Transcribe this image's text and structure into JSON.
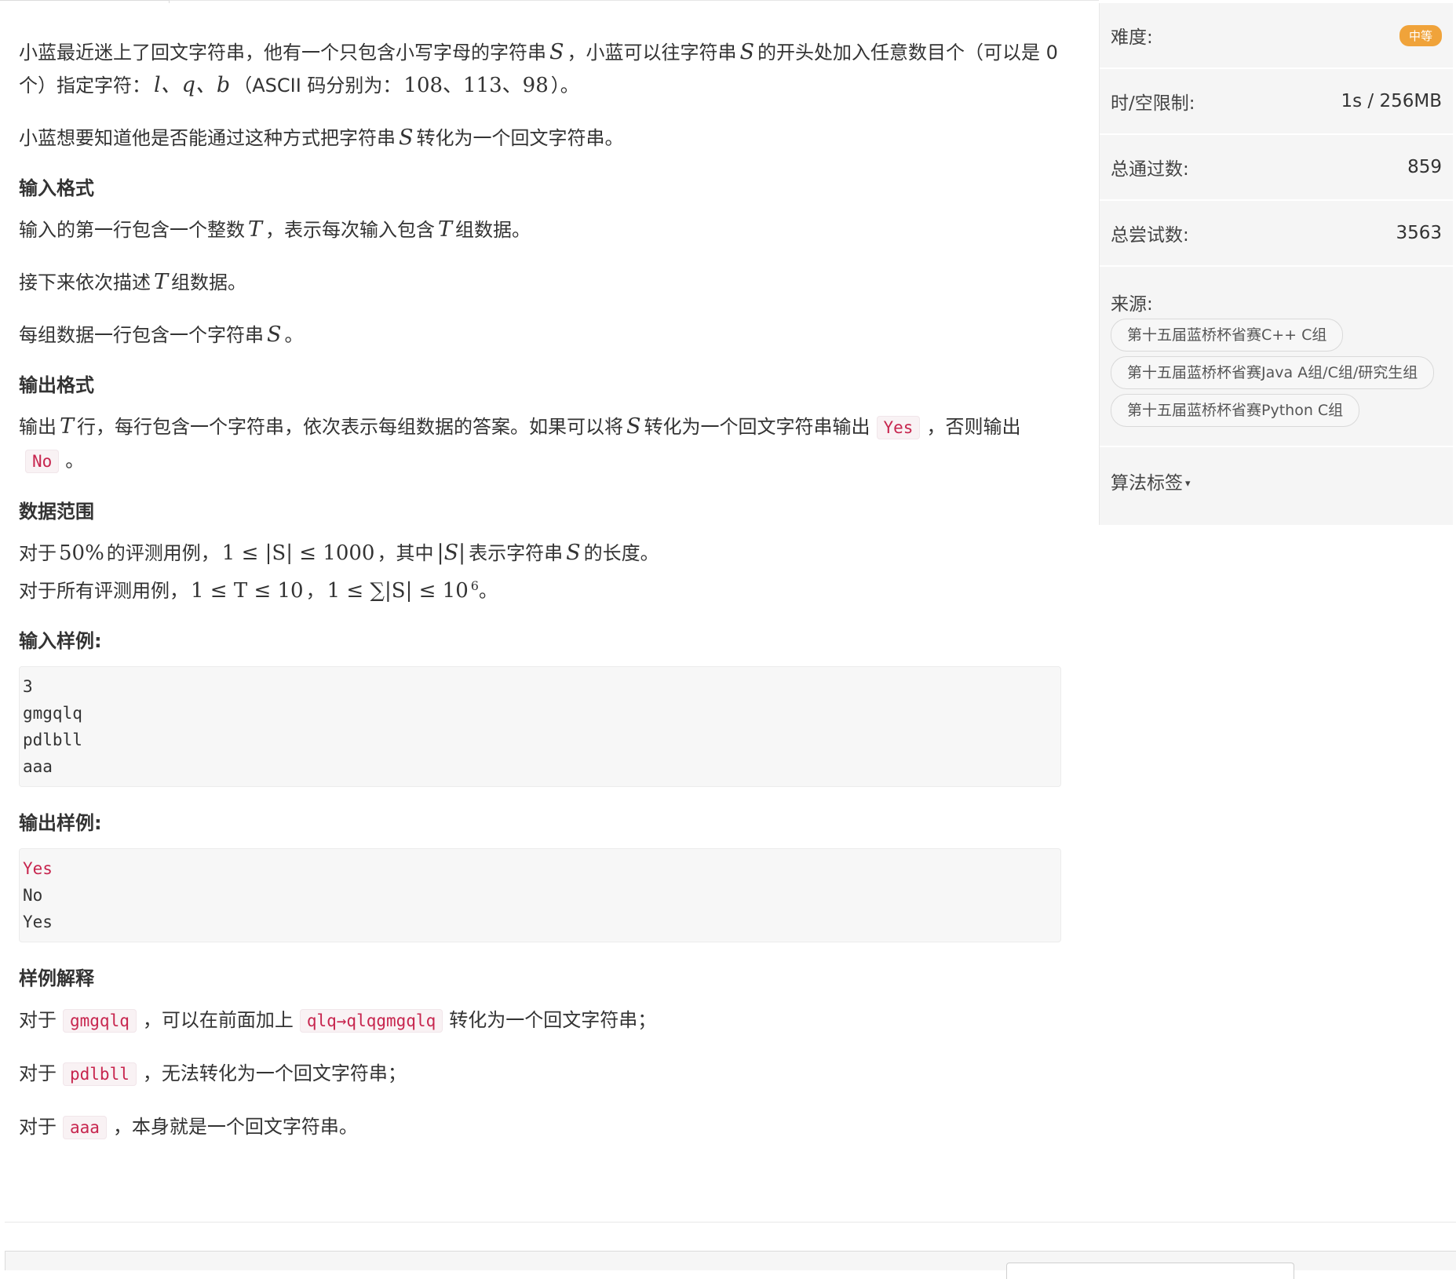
{
  "problem": {
    "p1a": "小蓝最近迷上了回文字符串，他有一个只包含小写字母的字符串",
    "p1b": "，小蓝可以往字符串",
    "p1c": "的开头处加入任意数目个（可以是 0 个）指定字符：",
    "p1d": "（ASCII 码分别为：",
    "p1e": "）。",
    "var_S": "S",
    "var_T": "T",
    "chars": "l、q、b",
    "ascii": "108、113、98",
    "p2a": "小蓝想要知道他是否能通过这种方式把字符串",
    "p2b": "转化为一个回文字符串。",
    "input_format_title": "输入格式",
    "in1a": "输入的第一行包含一个整数",
    "in1b": "，表示每次输入包含",
    "in1c": "组数据。",
    "in2a": "接下来依次描述",
    "in2b": "组数据。",
    "in3a": "每组数据一行包含一个字符串",
    "in3b": "。",
    "output_format_title": "输出格式",
    "out1a": "输出",
    "out1b": "行，每行包含一个字符串，依次表示每组数据的答案。如果可以将",
    "out1c": "转化为一个回文字符串输出",
    "out1d": "，否则输出",
    "out1e": "。",
    "yes": "Yes",
    "no": "No",
    "range_title": "数据范围",
    "r1a": "对于",
    "r1pct": "50%",
    "r1b": "的评测用例，",
    "r1expr": "1 ≤ |S| ≤ 1000",
    "r1c": "，其中",
    "r1abs": "|S|",
    "r1d": "表示字符串",
    "r1e": "的长度。",
    "r2a": "对于所有评测用例，",
    "r2expr1": "1 ≤ T ≤ 10",
    "r2sep": "，",
    "r2expr2": "1 ≤ ∑|S| ≤ 10",
    "r2exp": "6",
    "r2b": "。",
    "sample_in_title": "输入样例:",
    "sample_in": [
      "3",
      "gmgqlq",
      "pdlbll",
      "aaa"
    ],
    "sample_out_title": "输出样例:",
    "sample_out": [
      "Yes",
      "No",
      "Yes"
    ],
    "explain_title": "样例解释",
    "e_prefix": "对于",
    "e1_code": "gmgqlq",
    "e1_mid": "，可以在前面加上",
    "e1_code2": "qlq→qlqgmgqlq",
    "e1_end": "转化为一个回文字符串；",
    "e2_code": "pdlbll",
    "e2_end": "，无法转化为一个回文字符串；",
    "e3_code": "aaa",
    "e3_end": "，本身就是一个回文字符串。"
  },
  "sidebar": {
    "difficulty_label": "难度:",
    "difficulty_value": "中等",
    "limits_label": "时/空限制:",
    "limits_value": "1s / 256MB",
    "passed_label": "总通过数:",
    "passed_value": "859",
    "tries_label": "总尝试数:",
    "tries_value": "3563",
    "source_label": "来源:",
    "sources": [
      "第十五届蓝桥杯省赛C++ C组",
      "第十五届蓝桥杯省赛Java A组/C组/研究生组",
      "第十五届蓝桥杯省赛Python C组"
    ],
    "tags_label": "算法标签",
    "tags_caret": "▾"
  },
  "colors": {
    "code_red": "#c7254e",
    "badge_orange": "#f0a33a",
    "sidebar_bg": "#f5f5f5"
  }
}
